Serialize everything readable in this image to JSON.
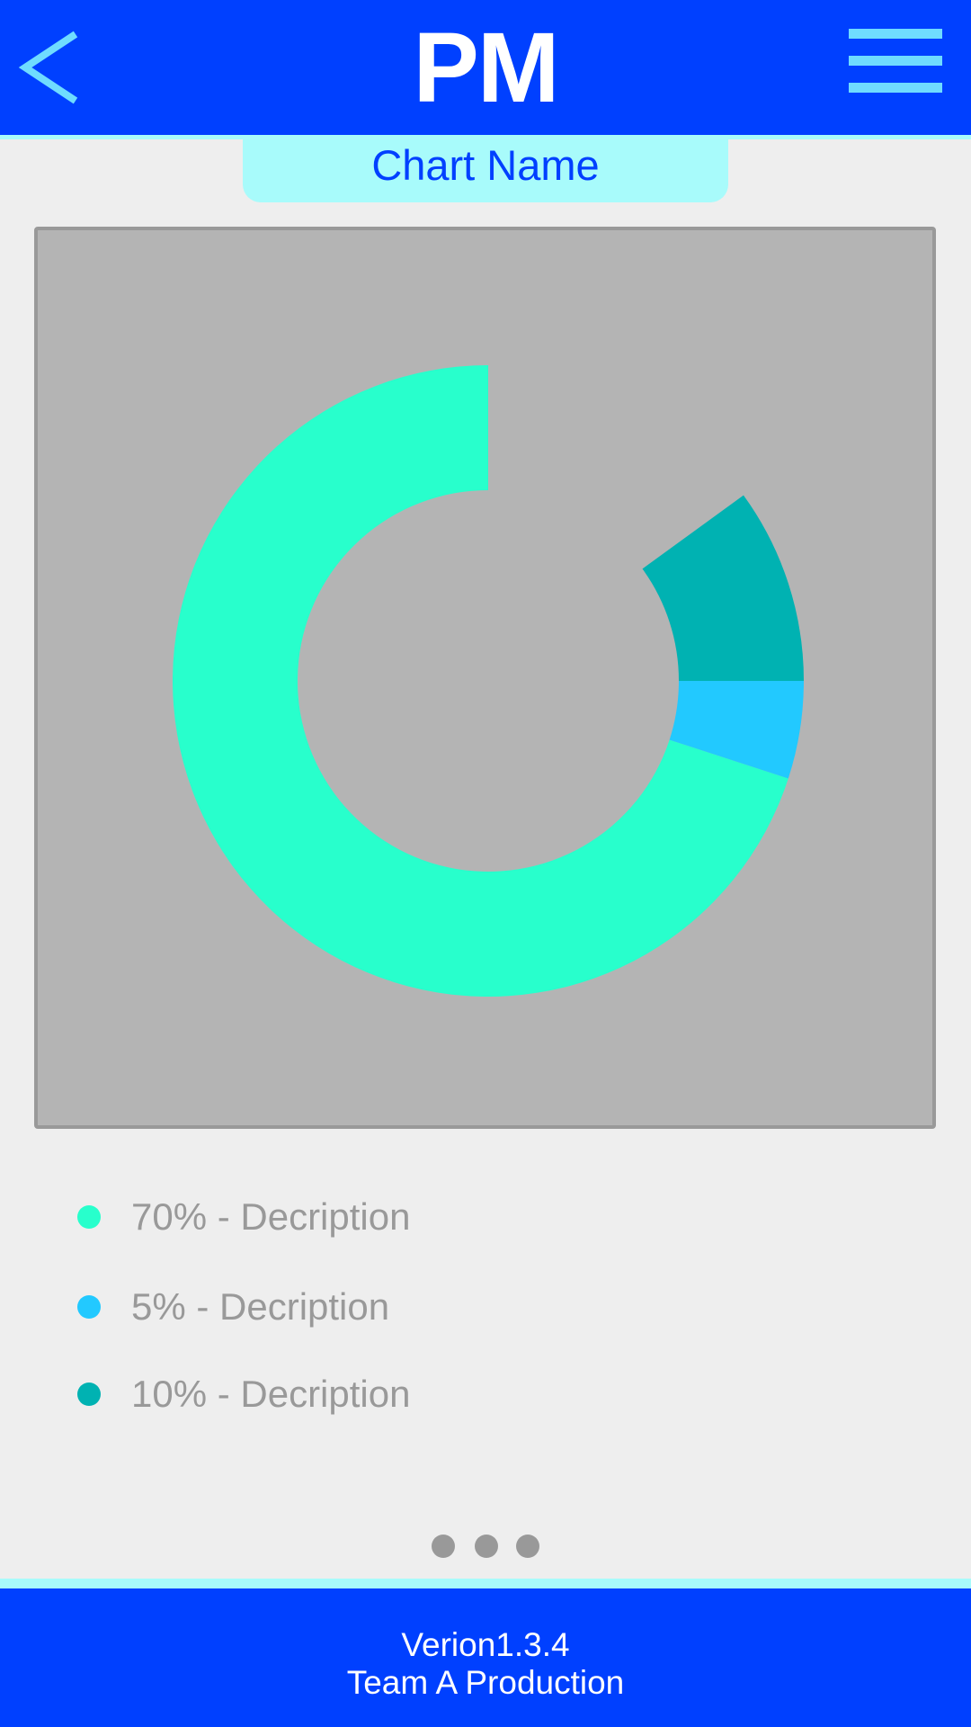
{
  "header": {
    "title": "PM",
    "back_icon": "chevron-left-icon",
    "menu_icon": "hamburger-menu-icon",
    "icon_color": "#6fdcff",
    "background": "#0040ff"
  },
  "chart_title": "Chart Name",
  "chart_data": {
    "type": "pie",
    "donut": true,
    "categories": [
      "70% - Decription",
      "5% - Decription",
      "10% - Decription"
    ],
    "values": [
      70,
      5,
      10
    ],
    "colors": [
      "#28ffcc",
      "#22c9ff",
      "#00b2b2"
    ],
    "title": "Chart Name",
    "legend_position": "bottom-left"
  },
  "legend": [
    {
      "label": "70% - Decription",
      "color": "#28ffcc"
    },
    {
      "label": "5% - Decription",
      "color": "#22c9ff"
    },
    {
      "label": "10% - Decription",
      "color": "#00b2b2"
    }
  ],
  "pagination": {
    "page_count": 3
  },
  "footer": {
    "version": "Verion1.3.4",
    "credit": "Team A Production"
  }
}
